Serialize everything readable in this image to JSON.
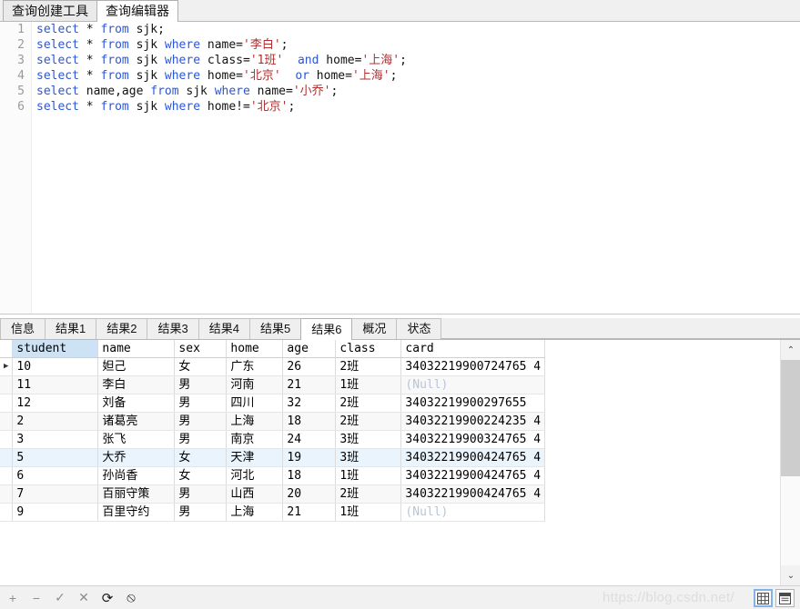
{
  "top_tabs": [
    {
      "label": "查询创建工具",
      "active": false,
      "name": "tab-query-builder"
    },
    {
      "label": "查询编辑器",
      "active": true,
      "name": "tab-query-editor"
    }
  ],
  "editor": {
    "line_numbers": [
      "1",
      "2",
      "3",
      "4",
      "5",
      "6"
    ],
    "lines": [
      [
        {
          "t": "select",
          "c": "kw"
        },
        {
          "t": " * ",
          "c": "pl"
        },
        {
          "t": "from",
          "c": "kw"
        },
        {
          "t": " sjk;",
          "c": "pl"
        }
      ],
      [
        {
          "t": "select",
          "c": "kw"
        },
        {
          "t": " * ",
          "c": "pl"
        },
        {
          "t": "from",
          "c": "kw"
        },
        {
          "t": " sjk ",
          "c": "pl"
        },
        {
          "t": "where",
          "c": "kw"
        },
        {
          "t": " name=",
          "c": "pl"
        },
        {
          "t": "'李白'",
          "c": "str"
        },
        {
          "t": ";",
          "c": "pl"
        }
      ],
      [
        {
          "t": "select",
          "c": "kw"
        },
        {
          "t": " * ",
          "c": "pl"
        },
        {
          "t": "from",
          "c": "kw"
        },
        {
          "t": " sjk ",
          "c": "pl"
        },
        {
          "t": "where",
          "c": "kw"
        },
        {
          "t": " class=",
          "c": "pl"
        },
        {
          "t": "'1班'",
          "c": "str"
        },
        {
          "t": "  ",
          "c": "pl"
        },
        {
          "t": "and",
          "c": "kw"
        },
        {
          "t": " home=",
          "c": "pl"
        },
        {
          "t": "'上海'",
          "c": "str"
        },
        {
          "t": ";",
          "c": "pl"
        }
      ],
      [
        {
          "t": "select",
          "c": "kw"
        },
        {
          "t": " * ",
          "c": "pl"
        },
        {
          "t": "from",
          "c": "kw"
        },
        {
          "t": " sjk ",
          "c": "pl"
        },
        {
          "t": "where",
          "c": "kw"
        },
        {
          "t": " home=",
          "c": "pl"
        },
        {
          "t": "'北京'",
          "c": "str"
        },
        {
          "t": "  ",
          "c": "pl"
        },
        {
          "t": "or",
          "c": "kw"
        },
        {
          "t": " home=",
          "c": "pl"
        },
        {
          "t": "'上海'",
          "c": "str"
        },
        {
          "t": ";",
          "c": "pl"
        }
      ],
      [
        {
          "t": "select",
          "c": "kw"
        },
        {
          "t": " name,age ",
          "c": "pl"
        },
        {
          "t": "from",
          "c": "kw"
        },
        {
          "t": " sjk ",
          "c": "pl"
        },
        {
          "t": "where",
          "c": "kw"
        },
        {
          "t": " name=",
          "c": "pl"
        },
        {
          "t": "'小乔'",
          "c": "str"
        },
        {
          "t": ";",
          "c": "pl"
        }
      ],
      [
        {
          "t": "select",
          "c": "kw"
        },
        {
          "t": " * ",
          "c": "pl"
        },
        {
          "t": "from",
          "c": "kw"
        },
        {
          "t": " sjk ",
          "c": "pl"
        },
        {
          "t": "where",
          "c": "kw"
        },
        {
          "t": " home!=",
          "c": "pl"
        },
        {
          "t": "'北京'",
          "c": "str"
        },
        {
          "t": ";",
          "c": "pl"
        }
      ]
    ]
  },
  "result_tabs": [
    {
      "label": "信息",
      "active": false,
      "name": "result-tab-info"
    },
    {
      "label": "结果1",
      "active": false,
      "name": "result-tab-1"
    },
    {
      "label": "结果2",
      "active": false,
      "name": "result-tab-2"
    },
    {
      "label": "结果3",
      "active": false,
      "name": "result-tab-3"
    },
    {
      "label": "结果4",
      "active": false,
      "name": "result-tab-4"
    },
    {
      "label": "结果5",
      "active": false,
      "name": "result-tab-5"
    },
    {
      "label": "结果6",
      "active": true,
      "name": "result-tab-6"
    },
    {
      "label": "概况",
      "active": false,
      "name": "result-tab-profile"
    },
    {
      "label": "状态",
      "active": false,
      "name": "result-tab-status"
    }
  ],
  "grid": {
    "columns": [
      {
        "label": "student",
        "width": 94,
        "selected": true,
        "align": "left"
      },
      {
        "label": "name",
        "width": 84,
        "selected": false,
        "align": "left"
      },
      {
        "label": "sex",
        "width": 57,
        "selected": false,
        "align": "left"
      },
      {
        "label": "home",
        "width": 62,
        "selected": false,
        "align": "left"
      },
      {
        "label": "age",
        "width": 58,
        "selected": false,
        "align": "right"
      },
      {
        "label": "class",
        "width": 72,
        "selected": false,
        "align": "left"
      },
      {
        "label": "card",
        "width": 151,
        "selected": false,
        "align": "left"
      }
    ],
    "null_text": "(Null)",
    "rows": [
      {
        "current": true,
        "cells": [
          "10",
          "妲己",
          "女",
          "广东",
          "26",
          "2班",
          "34032219900724765 4"
        ]
      },
      {
        "current": false,
        "cells": [
          "11",
          "李白",
          "男",
          "河南",
          "21",
          "1班",
          null
        ]
      },
      {
        "current": false,
        "cells": [
          "12",
          "刘备",
          "男",
          "四川",
          "32",
          "2班",
          "34032219900297655"
        ]
      },
      {
        "current": false,
        "cells": [
          "2",
          "诸葛亮",
          "男",
          "上海",
          "18",
          "2班",
          "34032219900224235 4"
        ]
      },
      {
        "current": false,
        "cells": [
          "3",
          "张飞",
          "男",
          "南京",
          "24",
          "3班",
          "34032219900324765 4"
        ]
      },
      {
        "current": false,
        "highlight": true,
        "cells": [
          "5",
          "大乔",
          "女",
          "天津",
          "19",
          "3班",
          "34032219900424765 4"
        ]
      },
      {
        "current": false,
        "cells": [
          "6",
          "孙尚香",
          "女",
          "河北",
          "18",
          "1班",
          "34032219900424765 4"
        ]
      },
      {
        "current": false,
        "cells": [
          "7",
          "百丽守策",
          "男",
          "山西",
          "20",
          "2班",
          "34032219900424765 4"
        ]
      },
      {
        "current": false,
        "cells": [
          "9",
          "百里守约",
          "男",
          "上海",
          "21",
          "1班",
          null
        ]
      }
    ]
  },
  "scrollbar": {
    "up_glyph": "⌃",
    "down_glyph": "⌄"
  },
  "bottom_toolbar": {
    "buttons": [
      {
        "glyph": "+",
        "name": "add-record-button",
        "enabled": false
      },
      {
        "glyph": "−",
        "name": "delete-record-button",
        "enabled": false
      },
      {
        "glyph": "✓",
        "name": "apply-changes-button",
        "enabled": false
      },
      {
        "glyph": "✕",
        "name": "cancel-changes-button",
        "enabled": false
      },
      {
        "glyph": "⟳",
        "name": "refresh-button",
        "enabled": true
      },
      {
        "glyph": "⦸",
        "name": "stop-button",
        "enabled": true
      }
    ],
    "watermark": "https://blog.csdn.net/",
    "view_buttons": [
      {
        "name": "grid-view-button",
        "selected": true
      },
      {
        "name": "form-view-button",
        "selected": false
      }
    ]
  },
  "colors": {
    "keyword": "#2b56d8",
    "string": "#b03030",
    "selected_header": "#cde3f5",
    "row_highlight": "#eaf4fc",
    "null_text": "#b9c4d6"
  }
}
